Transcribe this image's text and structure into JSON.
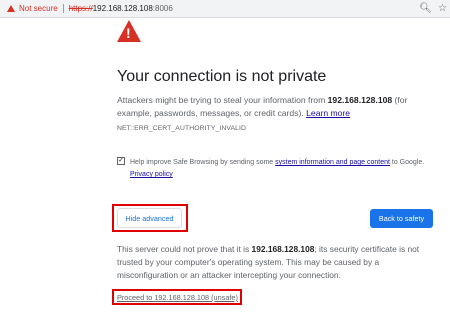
{
  "addressbar": {
    "not_secure": "Not secure",
    "url_scheme": "https://",
    "url_host": "192.168.128.108",
    "url_port": ":8006",
    "zoom_icon": "zoom-icon",
    "star_icon": "bookmark-star-icon"
  },
  "content": {
    "warning_icon": "warning-triangle-icon",
    "title": "Your connection is not private",
    "para_pre": "Attackers might be trying to steal your information from ",
    "host": "192.168.128.108",
    "para_post": " (for example, passwords, messages, or credit cards). ",
    "learn_more": "Learn more",
    "error_code": "NET::ERR_CERT_AUTHORITY_INVALID",
    "safebrowsing": {
      "checked": true,
      "text_pre": "Help improve Safe Browsing by sending some ",
      "link_text": "system information and page content",
      "text_post": " to Google.",
      "privacy_link": "Privacy policy"
    },
    "hide_advanced": "Hide advanced",
    "back_to_safety": "Back to safety",
    "details_pre": "This server could not prove that it is ",
    "details_host": "192.168.128.108",
    "details_post": "; its security certificate is not trusted by your computer's operating system. This may be caused by a misconfiguration or an attacker intercepting your connection.",
    "proceed_link": "Proceed to 192.168.128.108 (unsafe)"
  },
  "colors": {
    "danger": "#d93025",
    "primary": "#1a73e8",
    "highlight": "#e00000"
  }
}
